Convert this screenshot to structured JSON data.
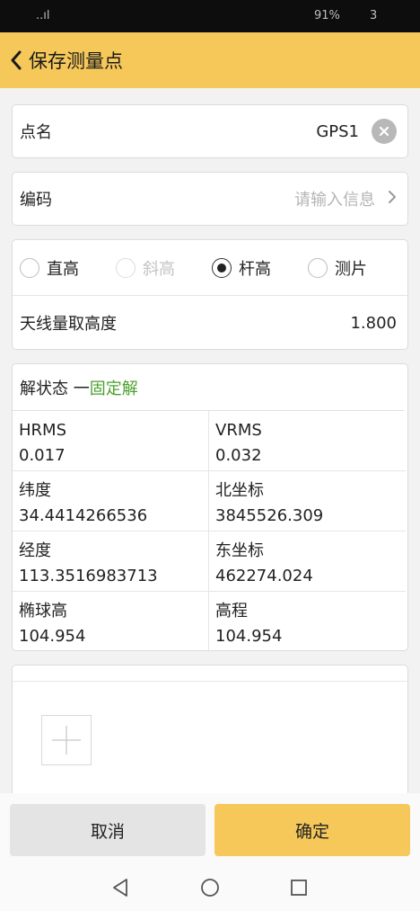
{
  "status_bar": {
    "signal": "..ıl",
    "battery": "91%",
    "time": "3"
  },
  "header": {
    "title": "保存测量点"
  },
  "point_name": {
    "label": "点名",
    "value": "GPS1"
  },
  "code": {
    "label": "编码",
    "placeholder": "请输入信息"
  },
  "height_type": {
    "options": [
      {
        "label": "直高",
        "state": "unchecked"
      },
      {
        "label": "斜高",
        "state": "disabled"
      },
      {
        "label": "杆高",
        "state": "checked"
      },
      {
        "label": "测片",
        "state": "unchecked"
      }
    ],
    "antenna_label": "天线量取高度",
    "antenna_value": "1.800"
  },
  "solution": {
    "label": "解状态 一",
    "status": "固定解",
    "status_color": "#4aa02c",
    "cells": [
      {
        "label": "HRMS",
        "value": "0.017"
      },
      {
        "label": "VRMS",
        "value": "0.032"
      },
      {
        "label": "纬度",
        "value": "34.4414266536"
      },
      {
        "label": "北坐标",
        "value": "3845526.309"
      },
      {
        "label": "经度",
        "value": "113.3516983713"
      },
      {
        "label": "东坐标",
        "value": "462274.024"
      },
      {
        "label": "椭球高",
        "value": "104.954"
      },
      {
        "label": "高程",
        "value": "104.954"
      }
    ]
  },
  "footer": {
    "cancel_label": "取消",
    "confirm_label": "确定"
  },
  "colors": {
    "accent": "#f6c85a",
    "header_bg": "#f6c85a"
  }
}
